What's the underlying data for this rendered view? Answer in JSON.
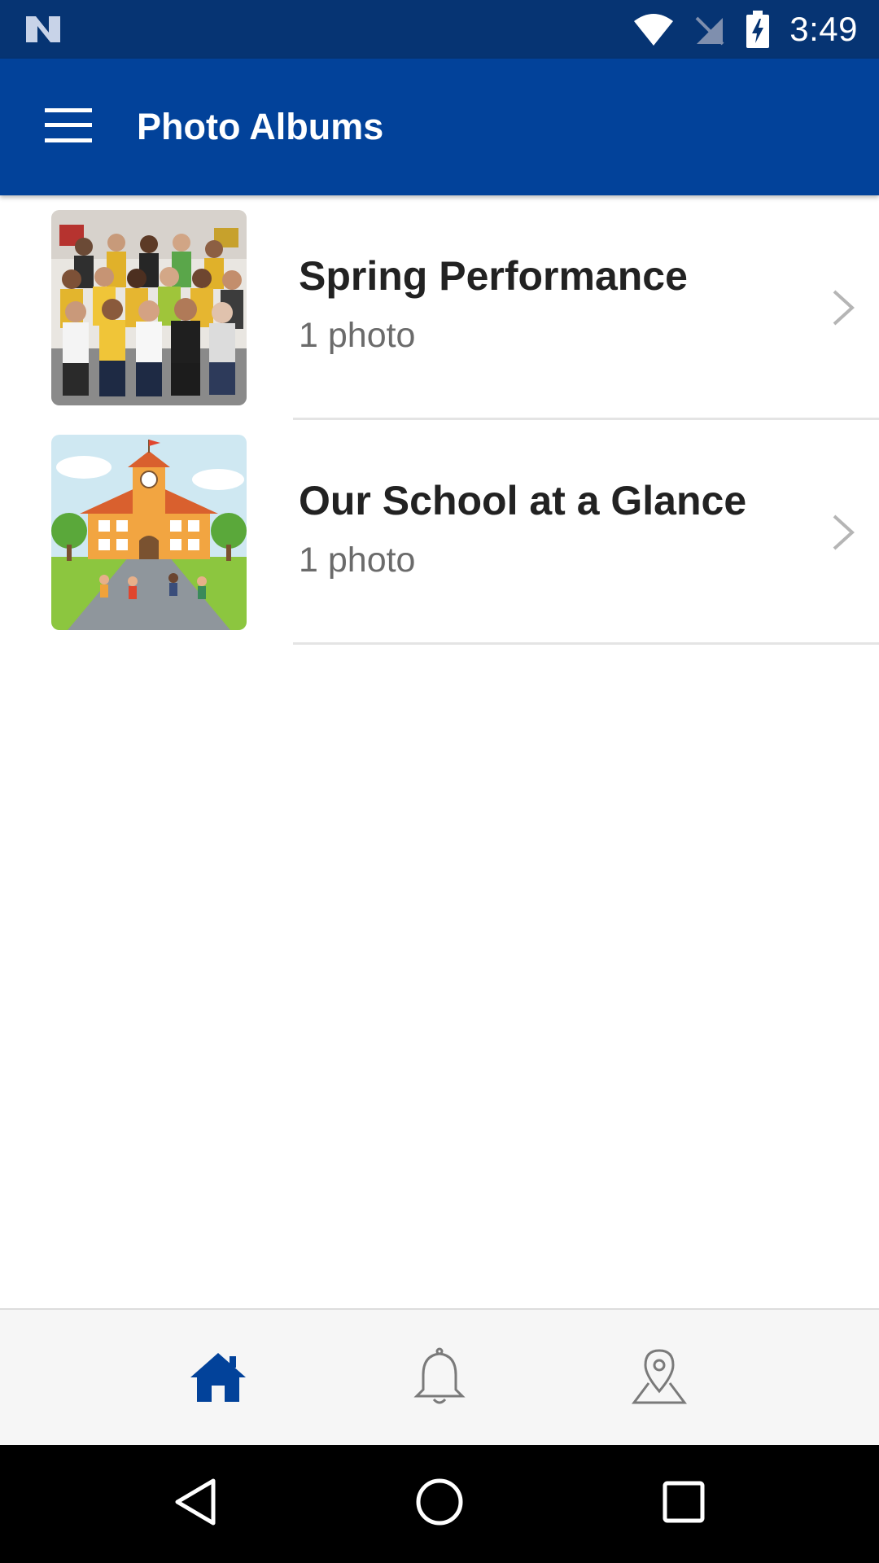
{
  "status_bar": {
    "time": "3:49",
    "icons": [
      "n-notification-icon",
      "wifi-icon",
      "no-signal-icon",
      "battery-charging-icon"
    ]
  },
  "app_bar": {
    "title": "Photo Albums",
    "menu_icon": "hamburger-menu-icon"
  },
  "albums": [
    {
      "title": "Spring Performance",
      "count": "1 photo",
      "thumbnail": "group-photo"
    },
    {
      "title": "Our School at a Glance",
      "count": "1 photo",
      "thumbnail": "school-illustration"
    }
  ],
  "tab_bar": {
    "tabs": [
      {
        "icon": "home-icon",
        "active": true
      },
      {
        "icon": "bell-icon",
        "active": false
      },
      {
        "icon": "map-pin-icon",
        "active": false
      }
    ]
  },
  "nav_bar": {
    "buttons": [
      "back-icon",
      "home-circle-icon",
      "recents-icon"
    ]
  },
  "colors": {
    "status_bar": "#063473",
    "app_bar": "#02429a",
    "active_tab": "#02429a",
    "inactive_tab": "#7a7a7a"
  }
}
